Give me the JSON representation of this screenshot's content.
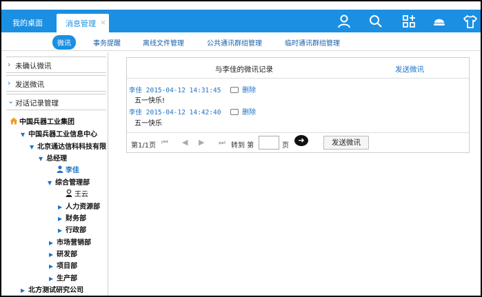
{
  "header": {
    "tab_desktop": "我的桌面",
    "tab_active": "消息管理",
    "tab_close": "×"
  },
  "subnav": {
    "items": [
      "微讯",
      "事务提醒",
      "离线文件管理",
      "公共通讯群组管理",
      "临时通讯群组管理"
    ]
  },
  "sidebar": {
    "sections": [
      "未确认微讯",
      "发送微讯",
      "对话记录管理"
    ],
    "tree": [
      "中国兵器工业集团",
      "中国兵器工业信息中心",
      "北京通达信科科技有限",
      "总经理",
      "李佳",
      "综合管理部",
      "王云",
      "人力资源部",
      "财务部",
      "行政部",
      "市场营销部",
      "研发部",
      "项目部",
      "生产部",
      "北方测试研究公司"
    ]
  },
  "main": {
    "title": "与李佳的微讯记录",
    "send_link": "发送微讯",
    "messages": [
      {
        "sender": "李佳",
        "time": "2015-04-12 14:31:45",
        "delete": "删除",
        "text": "五一快乐!"
      },
      {
        "sender": "李佳",
        "time": "2015-04-12 14:42:40",
        "delete": "删除",
        "text": "五一快乐"
      }
    ],
    "pager": {
      "page_info": "第1/1页",
      "goto": "转到 第",
      "page_unit": "页",
      "send_button": "发送微讯"
    }
  },
  "colors": {
    "accent": "#1b8fe2",
    "link": "#1b73c4"
  }
}
